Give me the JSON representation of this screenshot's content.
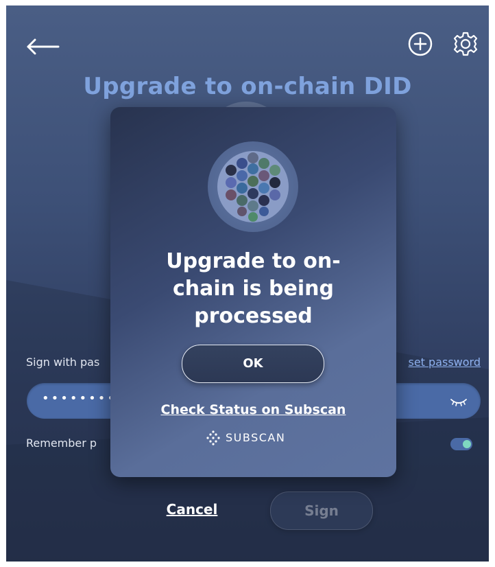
{
  "header": {
    "title": "Upgrade to on-chain DID",
    "back_icon": "arrow-left-icon",
    "add_icon": "plus-circle-icon",
    "settings_icon": "gear-icon"
  },
  "form": {
    "sign_label": "Sign with pas",
    "reset_link": "set password",
    "password_value": "••••••••",
    "eye_icon": "eye-closed-icon",
    "remember_label": "Remember p",
    "remember_enabled": true,
    "cancel_label": "Cancel",
    "sign_label_button": "Sign"
  },
  "modal": {
    "title": "Upgrade to on-chain is being processed",
    "ok_label": "OK",
    "check_status_link": "Check Status on Subscan",
    "logo_text": "SUBSCAN"
  },
  "colors": {
    "title_accent": "#7fa2dd",
    "link": "#8fb2f0",
    "toggle_knob": "#7fd8c0",
    "field_bg": "#4a6aa6"
  }
}
